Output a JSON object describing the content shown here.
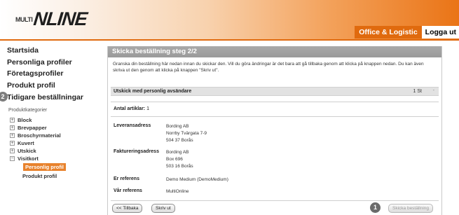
{
  "header": {
    "logo_small": "MULTI",
    "logo_big": "NLINE",
    "nav": {
      "active_label": "Office & Logistic",
      "logout_label": "Logga ut"
    }
  },
  "sidebar": {
    "items": [
      {
        "label": "Startsida"
      },
      {
        "label": "Personliga profiler"
      },
      {
        "label": "Företagsprofiler"
      },
      {
        "label": "Produkt profil"
      },
      {
        "label": "Tidigare beställningar"
      }
    ],
    "badge": "2",
    "category_heading": "Produktkategorier",
    "tree": [
      {
        "label": "Block",
        "toggle": "+"
      },
      {
        "label": "Brevpapper",
        "toggle": "+"
      },
      {
        "label": "Broschyrmaterial",
        "toggle": "+"
      },
      {
        "label": "Kuvert",
        "toggle": "+"
      },
      {
        "label": "Utskick",
        "toggle": "+"
      },
      {
        "label": "Visitkort",
        "toggle": "−"
      }
    ],
    "sub_items": [
      {
        "label": "Personlig profil",
        "active": true
      },
      {
        "label": "Produkt profil",
        "active": false
      }
    ]
  },
  "main": {
    "title": "Skicka beställning steg 2/2",
    "intro": "Granska din beställning här nedan innan du skickar den. Vill du göra ändringar är det bara att gå tillbaka genom att klicka på knappen nedan. Du kan även skriva ut den genom att klicka på knappen \"Skriv ut\".",
    "shipment": {
      "label": "Utskick med personlig avsändare",
      "qty": "1 St",
      "minus": "-"
    },
    "articles_label": "Antal artiklar:",
    "articles_count": "1",
    "delivery_label": "Leveransadress",
    "delivery_lines": [
      "Bording AB",
      "Norrby Tvärgata 7-9",
      "504 37 Borås"
    ],
    "invoice_label": "Faktureringsadress",
    "invoice_lines": [
      "Bording AB",
      "Box 696",
      "503 16 Borås"
    ],
    "your_ref_label": "Er referens",
    "your_ref_value": "Demo Medium (DemoMedium)",
    "our_ref_label": "Vår referens",
    "our_ref_value": "MultiOnline"
  },
  "footer": {
    "back_label": "<< Tillbaka",
    "print_label": "Skriv ut",
    "send_label": "Skicka beställning",
    "badge": "1"
  },
  "colors": {
    "accent": "#e06a0e",
    "panel_title": "#a3a3a3",
    "row_bg": "#e2e2e2"
  }
}
